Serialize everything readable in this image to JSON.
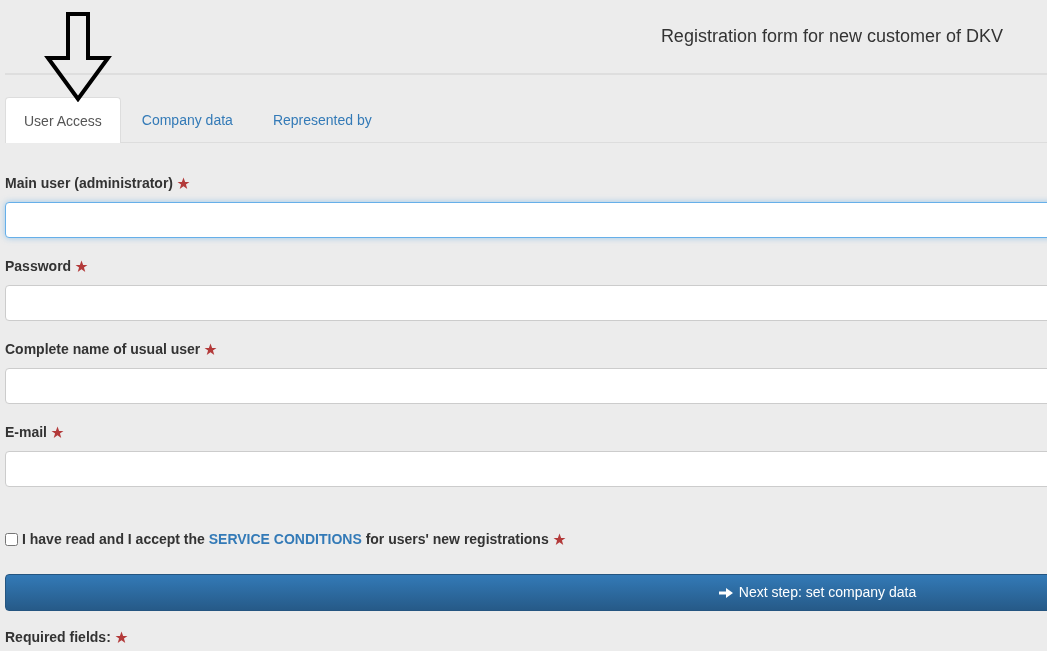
{
  "header": {
    "title": "Registration form for new customer of DKV"
  },
  "tabs": [
    {
      "label": "User Access",
      "selected": true
    },
    {
      "label": "Company data",
      "selected": false
    },
    {
      "label": "Represented by",
      "selected": false
    }
  ],
  "fields": [
    {
      "label": "Main user (administrator)",
      "required": true,
      "focused": true
    },
    {
      "label": "Password",
      "required": true,
      "focused": false
    },
    {
      "label": "Complete name of usual user",
      "required": true,
      "focused": false
    },
    {
      "label": "E-mail",
      "required": true,
      "focused": false
    }
  ],
  "consent": {
    "before": "I have read and I accept the",
    "link": "SERVICE CONDITIONS",
    "after": "for users' new registrations",
    "checked": false,
    "required": true
  },
  "next_button": {
    "label": "Next step: set company data"
  },
  "footnote": {
    "label": "Required fields:",
    "required": true
  }
}
